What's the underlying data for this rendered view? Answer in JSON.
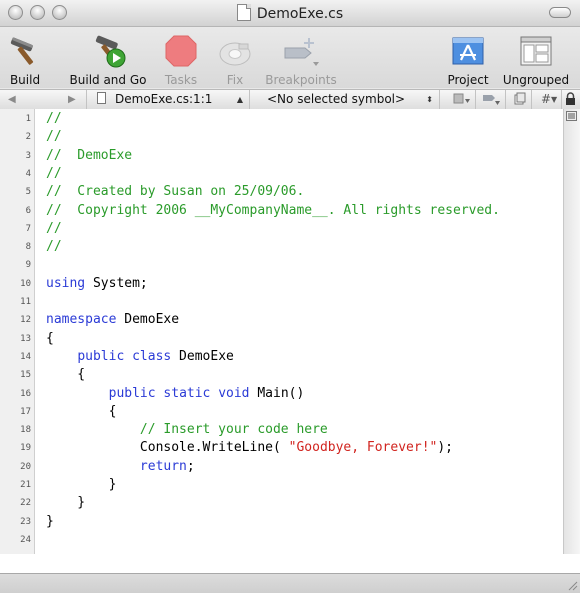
{
  "window": {
    "title": "DemoExe.cs"
  },
  "toolbar": {
    "items": [
      {
        "label": "Build",
        "icon": "hammer-icon",
        "enabled": true
      },
      {
        "label": "Build and Go",
        "icon": "hammer-run-icon",
        "enabled": true
      },
      {
        "label": "Tasks",
        "icon": "stop-icon",
        "enabled": false
      },
      {
        "label": "Fix",
        "icon": "fix-bandage-icon",
        "enabled": false
      },
      {
        "label": "Breakpoints",
        "icon": "breakpoints-icon",
        "enabled": false
      },
      {
        "label": "Project",
        "icon": "project-icon",
        "enabled": true
      },
      {
        "label": "Ungrouped",
        "icon": "ungrouped-icon",
        "enabled": true
      }
    ]
  },
  "navbar": {
    "file_position": "DemoExe.cs:1:1",
    "symbol": "<No selected symbol>",
    "hash_label": "#"
  },
  "editor": {
    "line_numbers": [
      "1",
      "2",
      "3",
      "4",
      "5",
      "6",
      "7",
      "8",
      "9",
      "10",
      "11",
      "12",
      "13",
      "14",
      "15",
      "16",
      "17",
      "18",
      "19",
      "20",
      "21",
      "22",
      "23",
      "24"
    ],
    "lines": [
      [
        {
          "t": "//",
          "c": "comment"
        }
      ],
      [
        {
          "t": "//",
          "c": "comment"
        }
      ],
      [
        {
          "t": "//  DemoExe",
          "c": "comment"
        }
      ],
      [
        {
          "t": "//",
          "c": "comment"
        }
      ],
      [
        {
          "t": "//  Created by Susan on 25/09/06.",
          "c": "comment"
        }
      ],
      [
        {
          "t": "//  Copyright 2006 __MyCompanyName__. All rights reserved.",
          "c": "comment"
        }
      ],
      [
        {
          "t": "//",
          "c": "comment"
        }
      ],
      [
        {
          "t": "//",
          "c": "comment"
        }
      ],
      [],
      [
        {
          "t": "using",
          "c": "kw"
        },
        {
          "t": " System;",
          "c": "plain"
        }
      ],
      [],
      [
        {
          "t": "namespace",
          "c": "kw"
        },
        {
          "t": " DemoExe",
          "c": "plain"
        }
      ],
      [
        {
          "t": "{",
          "c": "plain"
        }
      ],
      [
        {
          "t": "    ",
          "c": "plain"
        },
        {
          "t": "public class",
          "c": "kw"
        },
        {
          "t": " DemoExe",
          "c": "plain"
        }
      ],
      [
        {
          "t": "    {",
          "c": "plain"
        }
      ],
      [
        {
          "t": "        ",
          "c": "plain"
        },
        {
          "t": "public static void",
          "c": "kw"
        },
        {
          "t": " Main()",
          "c": "plain"
        }
      ],
      [
        {
          "t": "        {",
          "c": "plain"
        }
      ],
      [
        {
          "t": "            // Insert your code here",
          "c": "comment"
        }
      ],
      [
        {
          "t": "            Console.WriteLine( ",
          "c": "plain"
        },
        {
          "t": "\"Goodbye, Forever!\"",
          "c": "str"
        },
        {
          "t": ");",
          "c": "plain"
        }
      ],
      [
        {
          "t": "            ",
          "c": "plain"
        },
        {
          "t": "return",
          "c": "kw"
        },
        {
          "t": ";",
          "c": "plain"
        }
      ],
      [
        {
          "t": "        }",
          "c": "plain"
        }
      ],
      [
        {
          "t": "    }",
          "c": "plain"
        }
      ],
      [
        {
          "t": "}",
          "c": "plain"
        }
      ],
      []
    ]
  },
  "colors": {
    "comment": "#2a9b2a",
    "keyword": "#2b3bd6",
    "string": "#d1241f",
    "stop_red": "#e8434a"
  }
}
